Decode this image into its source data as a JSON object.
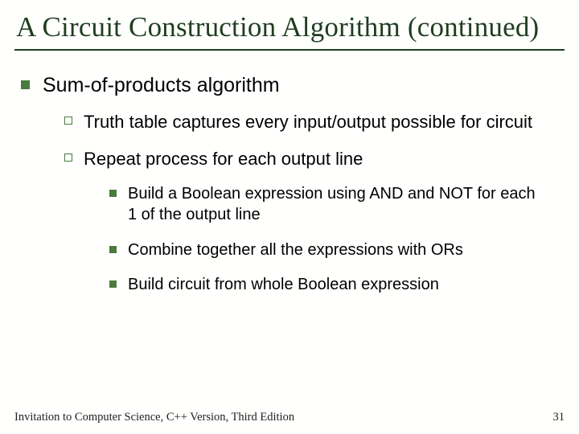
{
  "title": "A Circuit Construction Algorithm (continued)",
  "lvl1": {
    "item1": "Sum-of-products algorithm"
  },
  "lvl2": {
    "item1": "Truth table captures every input/output possible for circuit",
    "item2": "Repeat process for each output line"
  },
  "lvl3": {
    "item1": "Build a Boolean expression using AND and NOT for each 1 of the output line",
    "item2": "Combine together all the expressions with ORs",
    "item3": "Build circuit from whole Boolean expression"
  },
  "footer": {
    "left": "Invitation to Computer Science, C++ Version, Third Edition",
    "page": "31"
  }
}
